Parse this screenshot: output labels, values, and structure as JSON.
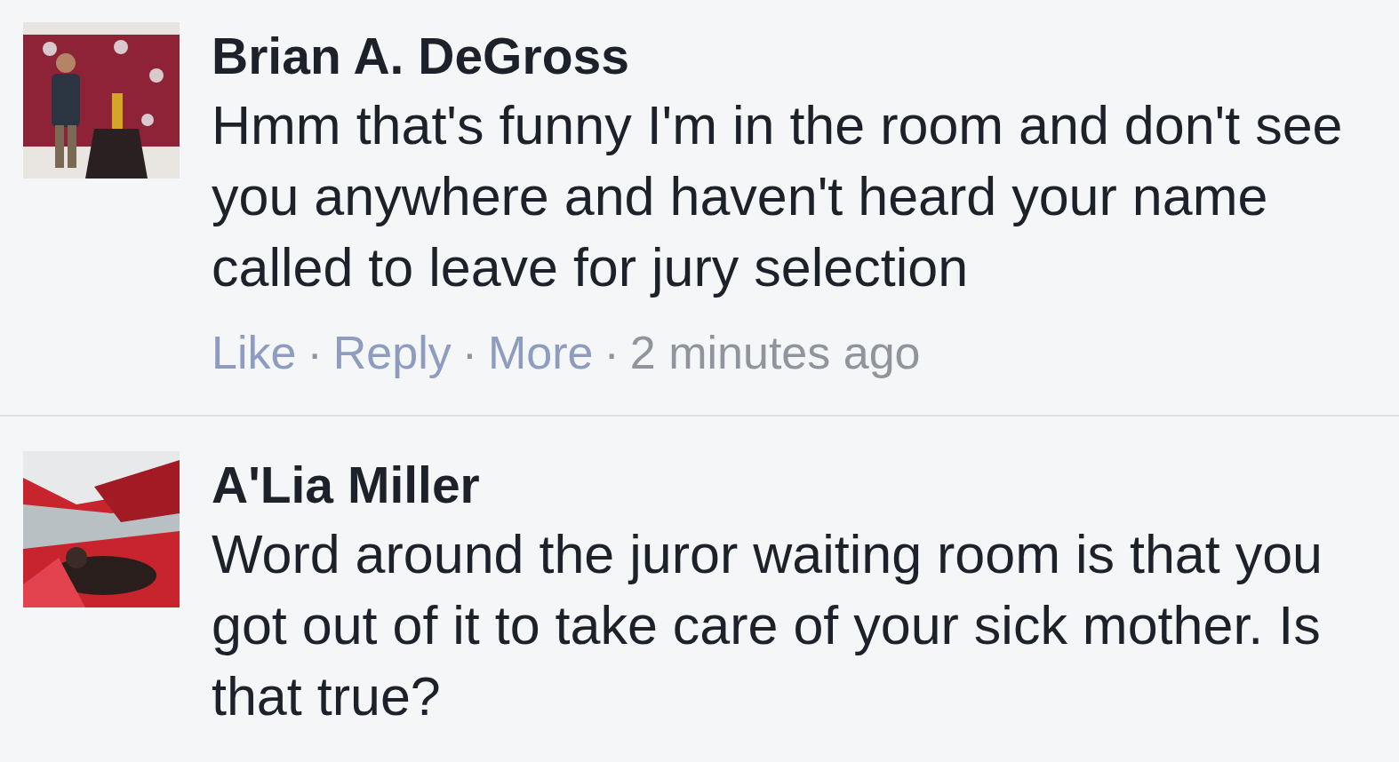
{
  "comments": [
    {
      "author": "Brian A. DeGross",
      "text": "Hmm that's funny I'm in the room and don't see you anywhere and haven't heard your name called to leave for jury selection",
      "actions": [
        {
          "kind": "link",
          "label": "Like"
        },
        {
          "kind": "separator",
          "label": "·"
        },
        {
          "kind": "link",
          "label": "Reply"
        },
        {
          "kind": "separator",
          "label": "·"
        },
        {
          "kind": "link",
          "label": "More"
        },
        {
          "kind": "separator",
          "label": "·"
        },
        {
          "kind": "time",
          "label": "2 minutes ago"
        }
      ]
    },
    {
      "author": "A'Lia Miller",
      "text": "Word around the juror waiting room is that you got out of it to take care of your sick mother. Is that true?"
    }
  ]
}
